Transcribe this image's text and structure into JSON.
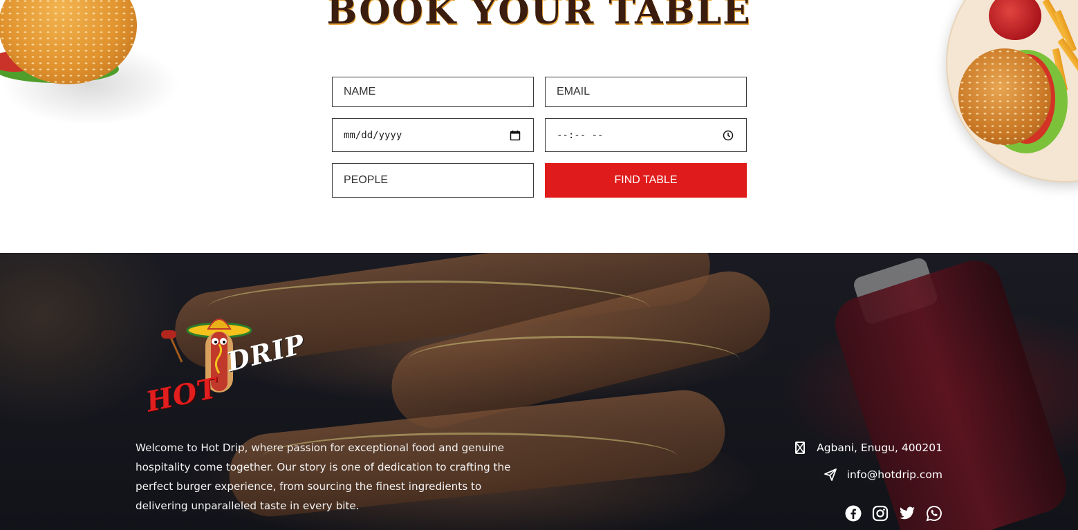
{
  "booking": {
    "title": "BOOK YOUR TABLE",
    "name_placeholder": "NAME",
    "email_placeholder": "EMAIL",
    "date_placeholder": "mm/dd/yyyy",
    "time_placeholder": "--:-- --",
    "people_placeholder": "PEOPLE",
    "submit_label": "FIND TABLE"
  },
  "footer": {
    "logo_hot": "HOT",
    "logo_drip": "DRIP",
    "about": "Welcome to Hot Drip, where passion for exceptional food and genuine hospitality come together. Our story is one of dedication to crafting the perfect burger experience, from sourcing the finest ingredients to delivering unparalleled taste in every bite.",
    "address": "Agbani, Enugu, 400201",
    "email": "info@hotdrip.com",
    "socials": [
      "facebook-icon",
      "instagram-icon",
      "twitter-icon",
      "whatsapp-icon"
    ]
  },
  "colors": {
    "accent_red": "#e01b1b",
    "title_brown": "#3a1d0e",
    "title_shadow": "#e8a63a",
    "footer_bg": "#121319"
  }
}
